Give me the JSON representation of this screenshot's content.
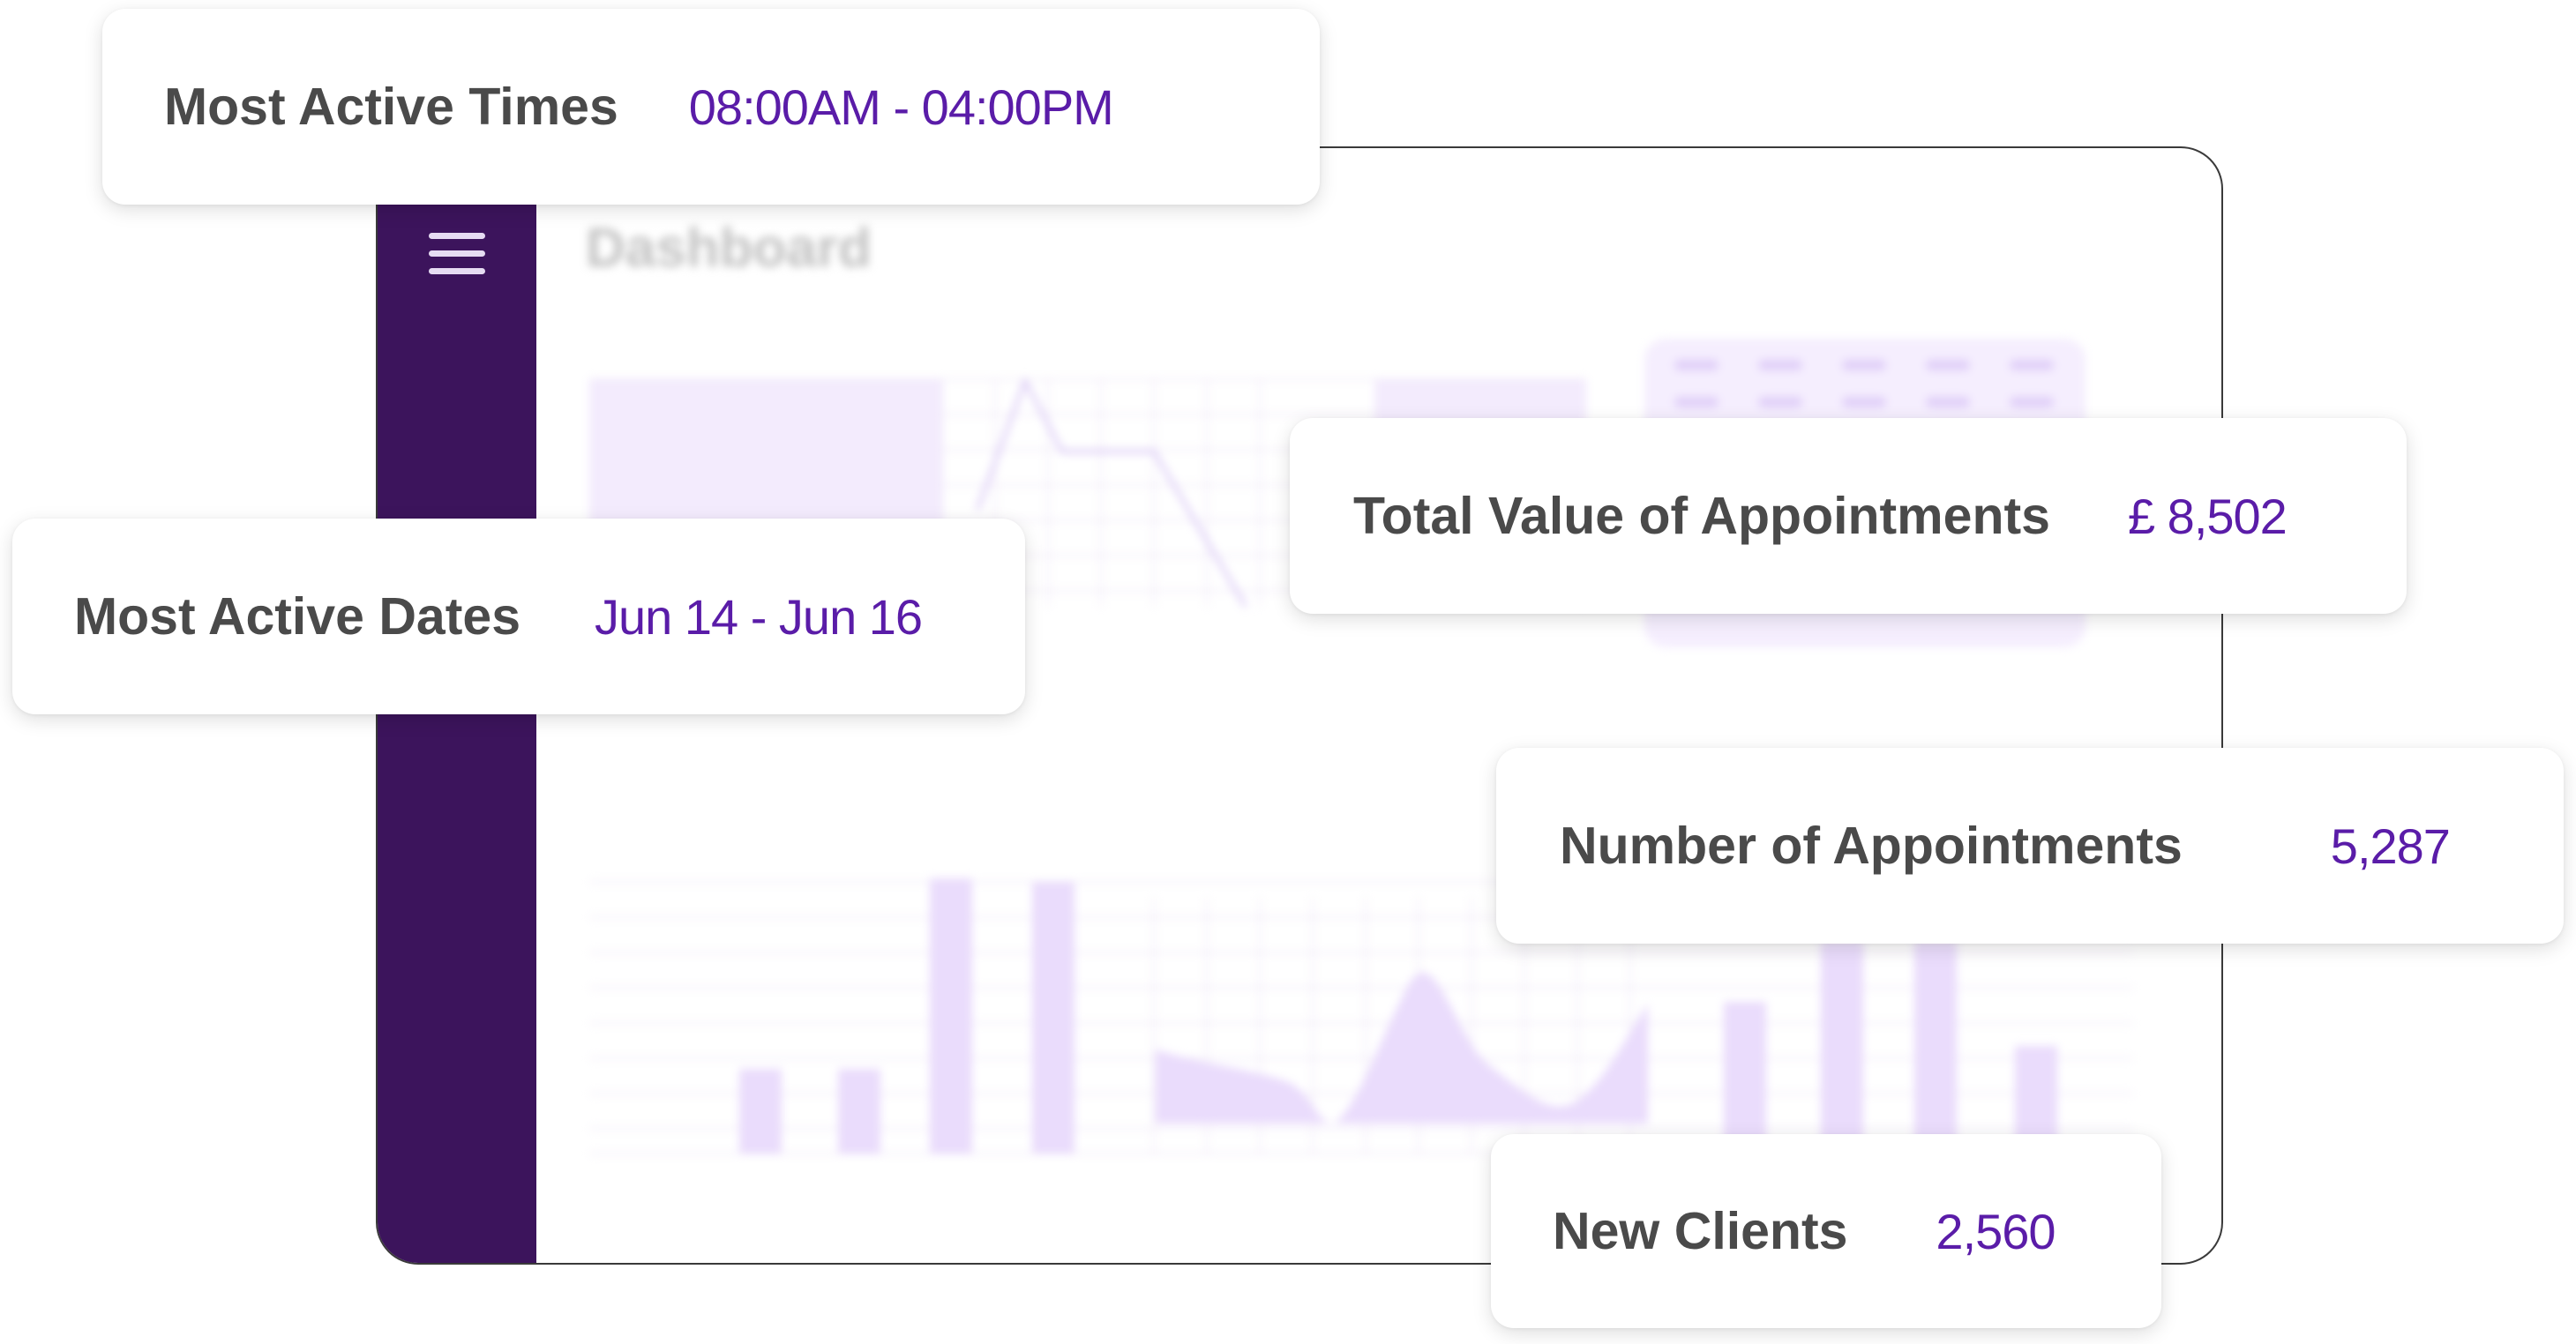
{
  "dashboard": {
    "title": "Dashboard",
    "sidebar_color": "#3c145c"
  },
  "accent": "#5a1ca8",
  "stats": {
    "most_active_times": {
      "label": "Most Active Times",
      "value": "08:00AM - 04:00PM"
    },
    "most_active_dates": {
      "label": "Most Active Dates",
      "value": "Jun 14 - Jun 16"
    },
    "total_value": {
      "label": "Total Value of Appointments",
      "value": "£ 8,502"
    },
    "number_of_appointments": {
      "label": "Number of Appointments",
      "value": "5,287"
    },
    "new_clients": {
      "label": "New Clients",
      "value": "2,560"
    }
  }
}
